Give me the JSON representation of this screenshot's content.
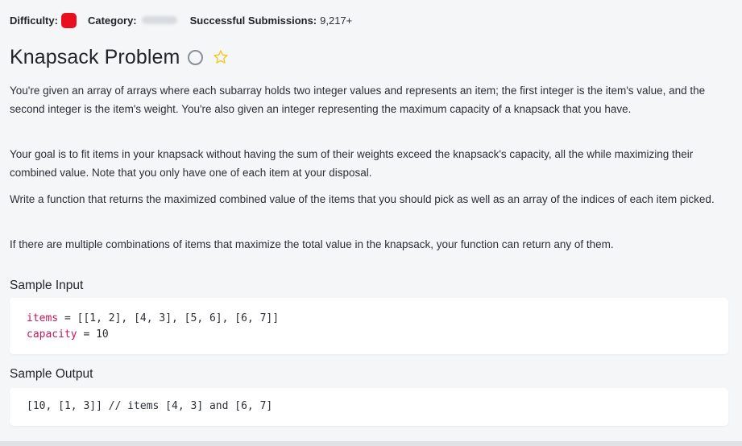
{
  "meta": {
    "difficulty_label": "Difficulty:",
    "difficulty_color": "#e8101c",
    "category_label": "Category:",
    "submissions_label": "Successful Submissions:",
    "submissions_value": "9,217+"
  },
  "title": "Knapsack Problem",
  "icons": {
    "status": "circle-icon",
    "favorite": "star-icon"
  },
  "description": [
    "You're given an array of arrays where each subarray holds two integer values and represents an item; the first integer is the item's value, and the second integer is the item's weight. You're also given an integer representing the maximum capacity of a knapsack that you have.",
    "Your goal is to fit items in your knapsack without having the sum of their weights exceed the knapsack's capacity, all the while maximizing their combined value. Note that you only have one of each item at your disposal.",
    "Write a function that returns the maximized combined value of the items that you should pick as well as an array of the indices of each item picked.",
    "If there are multiple combinations of items that maximize the total value in the knapsack, your function can return any of them."
  ],
  "sample_input": {
    "heading": "Sample Input",
    "lines": [
      {
        "name": "items",
        "op": " = ",
        "value": "[[1, 2], [4, 3], [5, 6], [6, 7]]"
      },
      {
        "name": "capacity",
        "op": " = ",
        "value": "10"
      }
    ]
  },
  "sample_output": {
    "heading": "Sample Output",
    "line": "[10, [1, 3]] // items [4, 3] and [6, 7]"
  },
  "colors": {
    "variable": "#c2185b",
    "star": "#f5c518"
  }
}
